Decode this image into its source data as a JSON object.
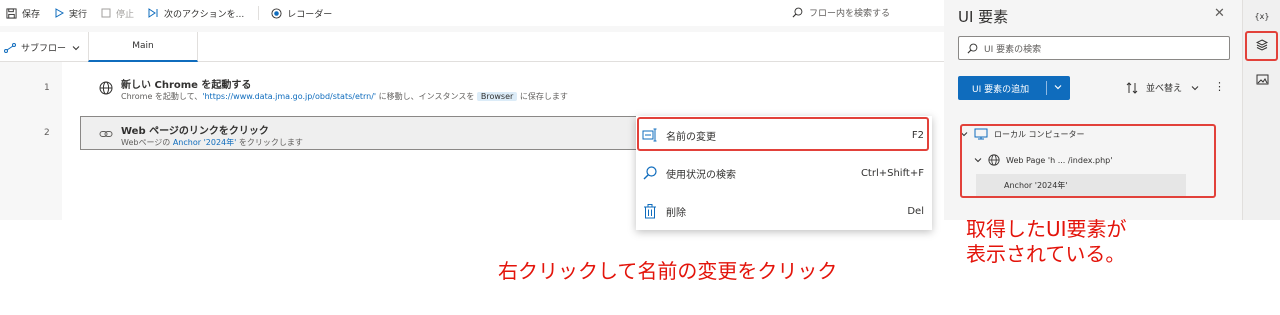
{
  "toolbar": {
    "save": "保存",
    "run": "実行",
    "stop": "停止",
    "next": "次のアクションを...",
    "recorder": "レコーダー",
    "search_placeholder": "フロー内を検索する"
  },
  "tabs": {
    "subflow": "サブフロー",
    "main": "Main"
  },
  "steps": [
    {
      "line": "1",
      "title": "新しい Chrome を起動する",
      "desc_pre": "Chrome を起動して、",
      "desc_link": "'https://www.data.jma.go.jp/obd/stats/etrn/'",
      "desc_mid": " に移動し、インスタンスを ",
      "desc_pill": "Browser",
      "desc_post": " に保存します"
    },
    {
      "line": "2",
      "title": "Web ページのリンクをクリック",
      "desc_pre": "Webページの ",
      "desc_link": "Anchor '2024年'",
      "desc_post": " をクリックします"
    }
  ],
  "context_menu": [
    {
      "label": "名前の変更",
      "shortcut": "F2",
      "icon": "rename-icon"
    },
    {
      "label": "使用状況の検索",
      "shortcut": "Ctrl+Shift+F",
      "icon": "search-icon"
    },
    {
      "label": "削除",
      "shortcut": "Del",
      "icon": "delete-icon"
    }
  ],
  "ui_panel": {
    "title": "UI 要素",
    "search_placeholder": "UI 要素の検索",
    "add_button": "UI 要素の追加",
    "sort": "並べ替え",
    "tree": {
      "computer": "ローカル コンピューター",
      "page": "Web Page 'h ... /index.php'",
      "element": "Anchor '2024年'"
    }
  },
  "rail": {
    "variables": "{x}"
  },
  "annotations": {
    "center": "右クリックして名前の変更をクリック",
    "right_line1": "取得したUI要素が",
    "right_line2": "表示されている。"
  },
  "colors": {
    "accent": "#0f6cbd",
    "highlight": "#e2413a",
    "annotation": "#e3140b"
  }
}
